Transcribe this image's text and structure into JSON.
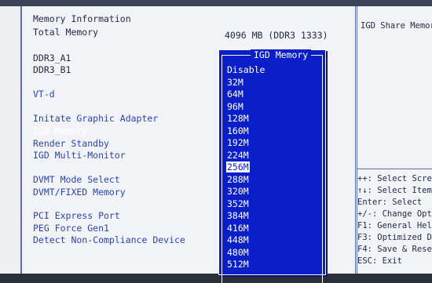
{
  "main": {
    "memory_info_heading": "Memory Information",
    "total_memory_label": "Total Memory",
    "total_memory_value": "4096 MB (DDR3 1333)",
    "ddr3_a1_label": "DDR3_A1",
    "ddr3_b1_label": "DDR3_B1",
    "vtd_label": "VT-d",
    "initiate_graphic_adapter": "Initate Graphic Adapter",
    "igd_memory": "IGD Memory",
    "render_standby": "Render Standby",
    "igd_multi_monitor": "IGD Multi-Monitor",
    "dvmt_mode_select": "DVMT Mode Select",
    "dvmt_fixed_memory": "DVMT/FIXED Memory",
    "pci_express_port": "PCI Express Port",
    "peg_force_gen1": "PEG Force Gen1",
    "detect_non_compliance": "Detect Non-Compliance Device"
  },
  "popup": {
    "title": "IGD Memory",
    "options": [
      "Disable",
      "32M",
      "64M",
      "96M",
      "128M",
      "160M",
      "192M",
      "224M",
      "256M",
      "288M",
      "320M",
      "352M",
      "384M",
      "416M",
      "448M",
      "480M",
      "512M"
    ],
    "selected_index": 8
  },
  "side": {
    "help_title": "IGD Share Memor",
    "keys": [
      "++: Select Scree",
      "↑↓: Select Item",
      "Enter: Select",
      "+/-: Change Opt.",
      "F1: General Help",
      "F3: Optimized De",
      "F4: Save & Reset",
      "ESC: Exit"
    ]
  },
  "colors": {
    "popup_bg": "#0b1fc9",
    "label_blue": "#2c44a8",
    "background": "#eef0f3"
  }
}
